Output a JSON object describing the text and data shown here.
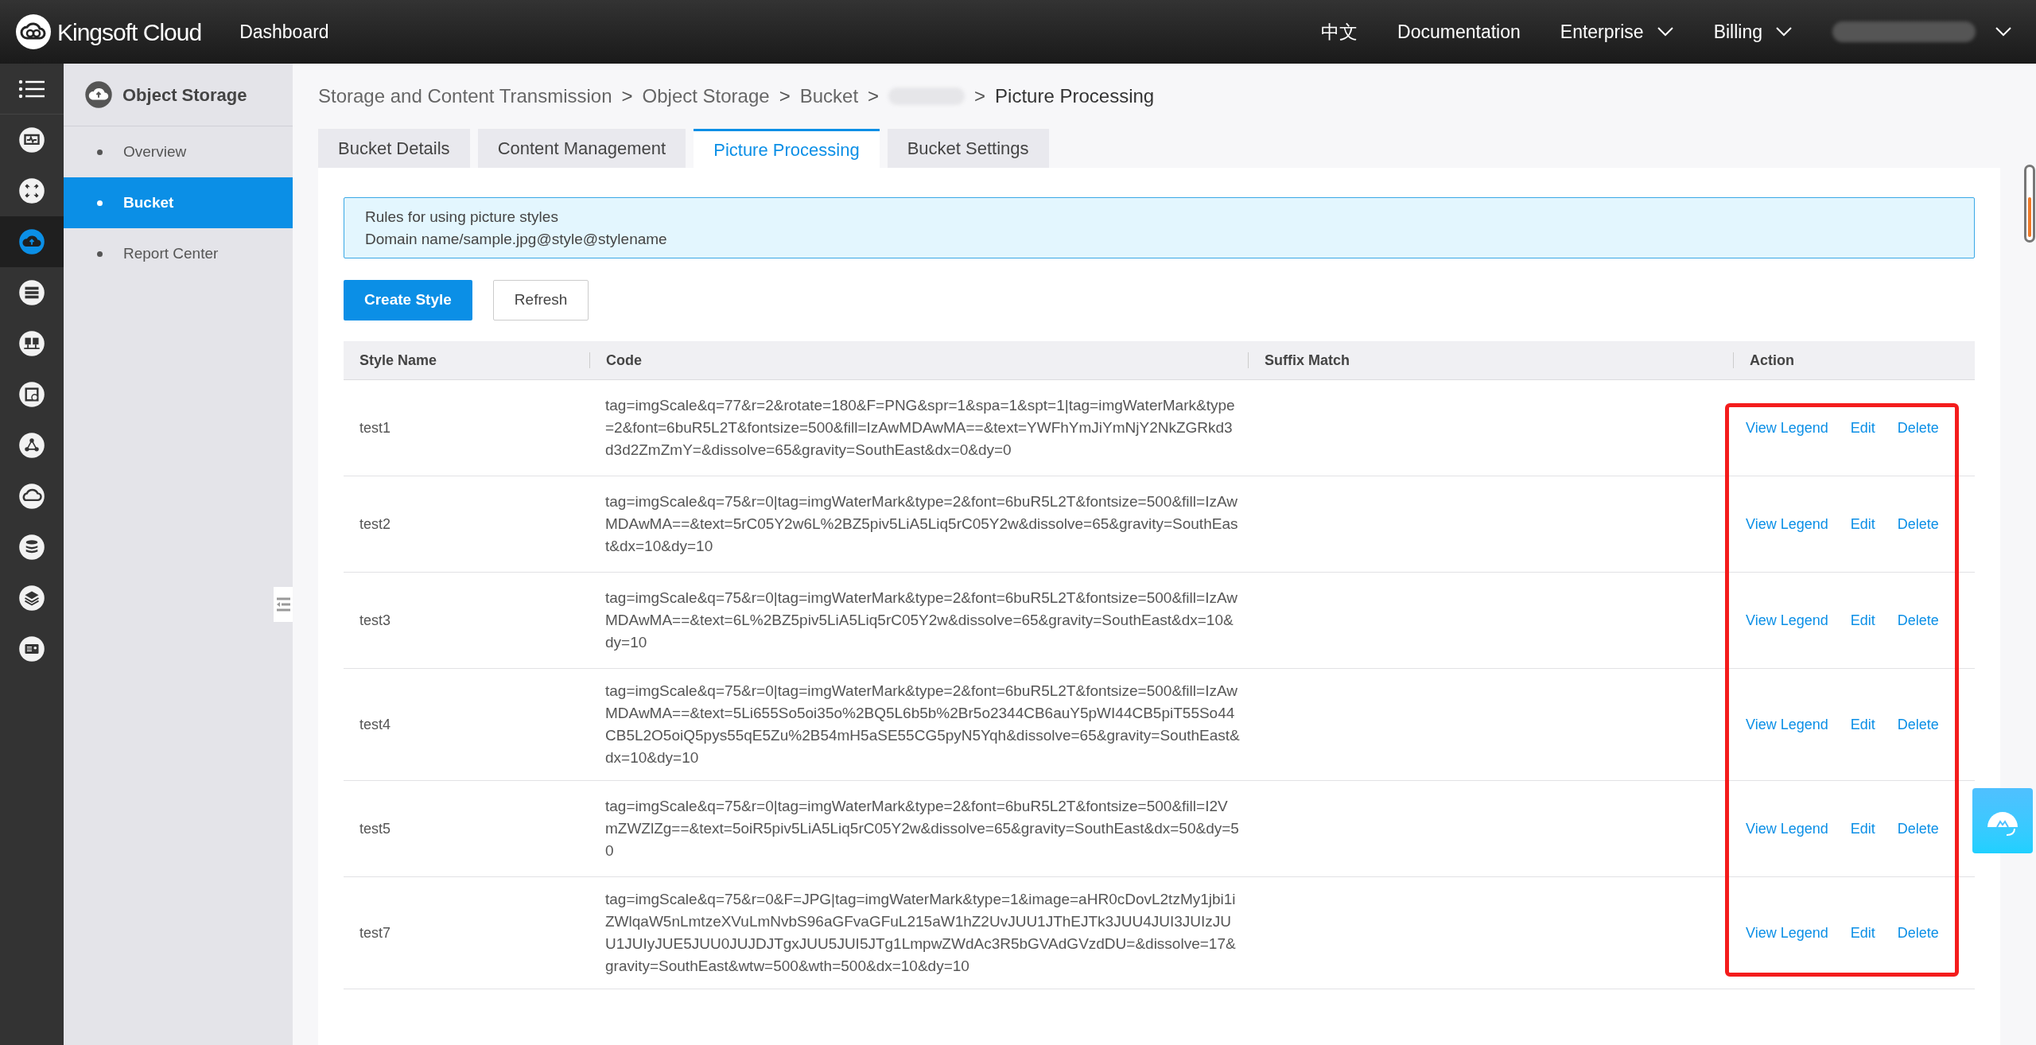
{
  "header": {
    "brand": "Kingsoft Cloud",
    "dashboard": "Dashboard",
    "nav": [
      {
        "label": "中文",
        "dropdown": false
      },
      {
        "label": "Documentation",
        "dropdown": false
      },
      {
        "label": "Enterprise",
        "dropdown": true
      },
      {
        "label": "Billing",
        "dropdown": true
      }
    ]
  },
  "rail_items": [
    {
      "selected": false
    },
    {
      "selected": false
    },
    {
      "selected": true
    },
    {
      "selected": false
    },
    {
      "selected": false
    },
    {
      "selected": false
    },
    {
      "selected": false
    },
    {
      "selected": false
    },
    {
      "selected": false
    },
    {
      "selected": false
    },
    {
      "selected": false
    }
  ],
  "sidebar": {
    "title": "Object Storage",
    "items": [
      {
        "label": "Overview",
        "selected": false
      },
      {
        "label": "Bucket",
        "selected": true
      },
      {
        "label": "Report Center",
        "selected": false
      }
    ]
  },
  "breadcrumb": [
    {
      "kind": "link",
      "label": "Storage and Content Transmission"
    },
    {
      "kind": "separator",
      "label": ">"
    },
    {
      "kind": "link",
      "label": "Object Storage"
    },
    {
      "kind": "separator",
      "label": ">"
    },
    {
      "kind": "link",
      "label": "Bucket"
    },
    {
      "kind": "separator",
      "label": ">"
    },
    {
      "kind": "blurred"
    },
    {
      "kind": "separator",
      "label": ">"
    },
    {
      "kind": "current",
      "label": "Picture Processing"
    }
  ],
  "tabs": [
    {
      "label": "Bucket Details",
      "selected": false
    },
    {
      "label": "Content Management",
      "selected": false
    },
    {
      "label": "Picture Processing",
      "selected": true
    },
    {
      "label": "Bucket Settings",
      "selected": false
    }
  ],
  "info": [
    "Rules for using picture styles",
    "Domain name/sample.jpg@style@stylename"
  ],
  "buttons": [
    {
      "label": "Create Style",
      "kind": "primary"
    },
    {
      "label": "Refresh",
      "kind": "default"
    }
  ],
  "table": {
    "columns": [
      "Style Name",
      "Code",
      "Suffix Match",
      "Action"
    ],
    "rows": [
      {
        "name": "test1",
        "code": "tag=imgScale&q=77&r=2&rotate=180&F=PNG&spr=1&spa=1&spt=1|tag=imgWaterMark&type=2&font=6buR5L2T&fontsize=500&fill=IzAwMDAwMA==&text=YWFhYmJiYmNjY2NkZGRkd3d3d2ZmZmY=&dissolve=65&gravity=SouthEast&dx=0&dy=0",
        "actions": [
          "View Legend",
          "Edit",
          "Delete"
        ]
      },
      {
        "name": "test2",
        "code": "tag=imgScale&q=75&r=0|tag=imgWaterMark&type=2&font=6buR5L2T&fontsize=500&fill=IzAwMDAwMA==&text=5rC05Y2w6L%2BZ5piv5LiA5Liq5rC05Y2w&dissolve=65&gravity=SouthEast&dx=10&dy=10",
        "actions": [
          "View Legend",
          "Edit",
          "Delete"
        ]
      },
      {
        "name": "test3",
        "code": "tag=imgScale&q=75&r=0|tag=imgWaterMark&type=2&font=6buR5L2T&fontsize=500&fill=IzAwMDAwMA==&text=6L%2BZ5piv5LiA5Liq5rC05Y2w&dissolve=65&gravity=SouthEast&dx=10&dy=10",
        "actions": [
          "View Legend",
          "Edit",
          "Delete"
        ]
      },
      {
        "name": "test4",
        "code": "tag=imgScale&q=75&r=0|tag=imgWaterMark&type=2&font=6buR5L2T&fontsize=500&fill=IzAwMDAwMA==&text=5Li655So5oi35o%2BQ5L6b5b%2Br5o2344CB6auY5pWI44CB5piT55So44CB5L2O5oiQ5pys55qE5Zu%2B54mH5aSE55CG5pyN5Yqh&dissolve=65&gravity=SouthEast&dx=10&dy=10",
        "actions": [
          "View Legend",
          "Edit",
          "Delete"
        ]
      },
      {
        "name": "test5",
        "code": "tag=imgScale&q=75&r=0|tag=imgWaterMark&type=2&font=6buR5L2T&fontsize=500&fill=I2VmZWZlZg==&text=5oiR5piv5LiA5Liq5rC05Y2w&dissolve=65&gravity=SouthEast&dx=50&dy=50",
        "actions": [
          "View Legend",
          "Edit",
          "Delete"
        ]
      },
      {
        "name": "test7",
        "code": "tag=imgScale&q=75&r=0&F=JPG|tag=imgWaterMark&type=1&image=aHR0cDovL2tzMy1jbi1iZWlqaW5nLmtzeXVuLmNvbS96aGFvaGFuL215aW1hZ2UvJUU1JThEJTk3JUU4JUI3JUIzJUU1JUIyJUE5JUU0JUJDJTgxJUU5JUI5JTg1LmpwZWdAc3R5bGVAdGVzdDU=&dissolve=17&gravity=SouthEast&wtw=500&wth=500&dx=10&dy=10",
        "actions": [
          "View Legend",
          "Edit",
          "Delete"
        ]
      }
    ]
  }
}
